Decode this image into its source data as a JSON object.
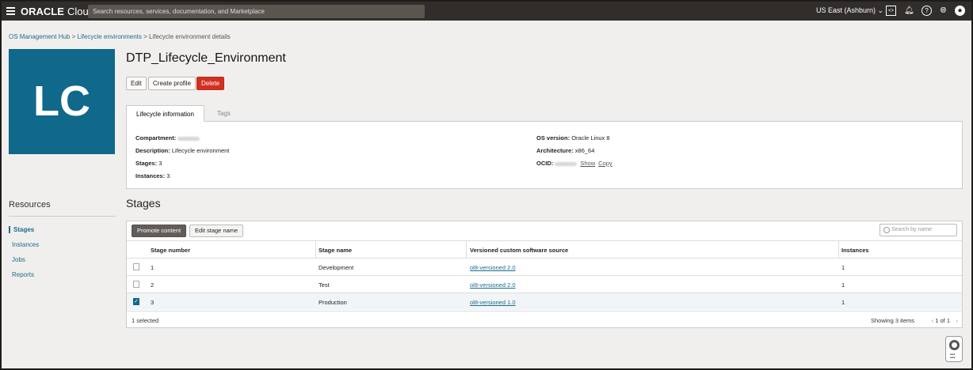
{
  "topbar": {
    "logo": "ORACLE",
    "logo_suffix": "Cloud",
    "search_placeholder": "Search resources, services, documentation, and Marketplace",
    "region": "US East (Ashburn)",
    "icons": [
      "code-editor-icon",
      "bell-icon",
      "help-icon",
      "globe-icon",
      "user-icon"
    ]
  },
  "breadcrumb": {
    "items": [
      "OS Management Hub",
      "Lifecycle environments"
    ],
    "current": "Lifecycle environment details",
    "sep": ">"
  },
  "tile": {
    "initials": "LC",
    "color": "#10688b"
  },
  "page": {
    "title": "DTP_Lifecycle_Environment",
    "buttons": {
      "edit": "Edit",
      "create_profile": "Create profile",
      "delete": "Delete"
    }
  },
  "tabs": [
    "Lifecycle information",
    "Tags"
  ],
  "info": {
    "compartment_label": "Compartment:",
    "description_label": "Description:",
    "description": "Lifecycle environment",
    "stages_label": "Stages:",
    "stages": "3",
    "instances_label": "Instances:",
    "instances": "3",
    "os_label": "OS version:",
    "os": "Oracle Linux 8",
    "arch_label": "Architecture:",
    "arch": "x86_64",
    "ocid_label": "OCID:",
    "show": "Show",
    "copy": "Copy"
  },
  "resources": {
    "title": "Resources",
    "items": [
      "Stages",
      "Instances",
      "Jobs",
      "Reports"
    ]
  },
  "stages": {
    "title": "Stages",
    "promote": "Promote content",
    "edit_name": "Edit stage name",
    "search_placeholder": "Search by name",
    "columns": [
      "Stage number",
      "Stage name",
      "Versioned custom software source",
      "Instances"
    ],
    "rows": [
      {
        "number": "1",
        "name": "Development",
        "source": "ol8-versioned 2.0",
        "instances": "1",
        "selected": false
      },
      {
        "number": "2",
        "name": "Test",
        "source": "ol8-versioned 2.0",
        "instances": "1",
        "selected": false
      },
      {
        "number": "3",
        "name": "Production",
        "source": "ol8-versioned 1.0",
        "instances": "1",
        "selected": true
      }
    ],
    "selected_text": "1 selected",
    "showing": "Showing 3 items",
    "page": "1 of 1"
  }
}
